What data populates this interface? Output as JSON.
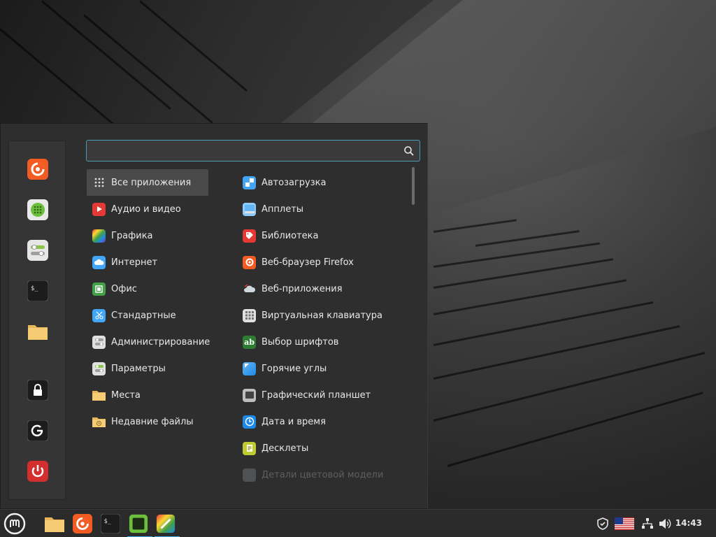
{
  "search": {
    "placeholder": "",
    "value": ""
  },
  "sidebar": {
    "favorites": [
      {
        "name": "firefox-icon"
      },
      {
        "name": "software-manager-icon"
      },
      {
        "name": "system-settings-icon"
      },
      {
        "name": "terminal-icon"
      },
      {
        "name": "files-folder-icon"
      }
    ],
    "session": [
      {
        "name": "lock-screen-icon"
      },
      {
        "name": "logout-icon"
      },
      {
        "name": "power-icon"
      }
    ]
  },
  "categories": [
    {
      "label": "Все приложения",
      "icon": "grid-icon",
      "active": true
    },
    {
      "label": "Аудио и видео",
      "icon": "media-icon"
    },
    {
      "label": "Графика",
      "icon": "graphics-icon"
    },
    {
      "label": "Интернет",
      "icon": "cloud-icon"
    },
    {
      "label": "Офис",
      "icon": "office-icon"
    },
    {
      "label": "Стандартные",
      "icon": "scissors-icon"
    },
    {
      "label": "Администрирование",
      "icon": "toggles-icon"
    },
    {
      "label": "Параметры",
      "icon": "settings-toggles-icon"
    },
    {
      "label": "Места",
      "icon": "folder-icon"
    },
    {
      "label": "Недавние файлы",
      "icon": "recent-folder-icon"
    }
  ],
  "apps": [
    {
      "label": "Автозагрузка",
      "icon": "startup-icon"
    },
    {
      "label": "Апплеты",
      "icon": "applets-icon"
    },
    {
      "label": "Библиотека",
      "icon": "library-icon"
    },
    {
      "label": "Веб-браузер Firefox",
      "icon": "firefox-icon"
    },
    {
      "label": "Веб-приложения",
      "icon": "webapps-icon"
    },
    {
      "label": "Виртуальная клавиатура",
      "icon": "keyboard-icon"
    },
    {
      "label": "Выбор шрифтов",
      "icon": "fonts-icon"
    },
    {
      "label": "Горячие углы",
      "icon": "hot-corners-icon"
    },
    {
      "label": "Графический планшет",
      "icon": "tablet-icon"
    },
    {
      "label": "Дата и время",
      "icon": "clock-icon"
    },
    {
      "label": "Десклеты",
      "icon": "desklets-icon"
    },
    {
      "label": "Детали цветовой модели",
      "icon": "color-icon",
      "faded": true
    }
  ],
  "taskbar": {
    "clock": "14:43",
    "keyboard_layout": "us-flag"
  },
  "colors": {
    "accent": "#3daee9",
    "search_border": "#4a9bb4",
    "active_category": "#4a4a4a",
    "menu_bg": "#2e2e2e"
  }
}
